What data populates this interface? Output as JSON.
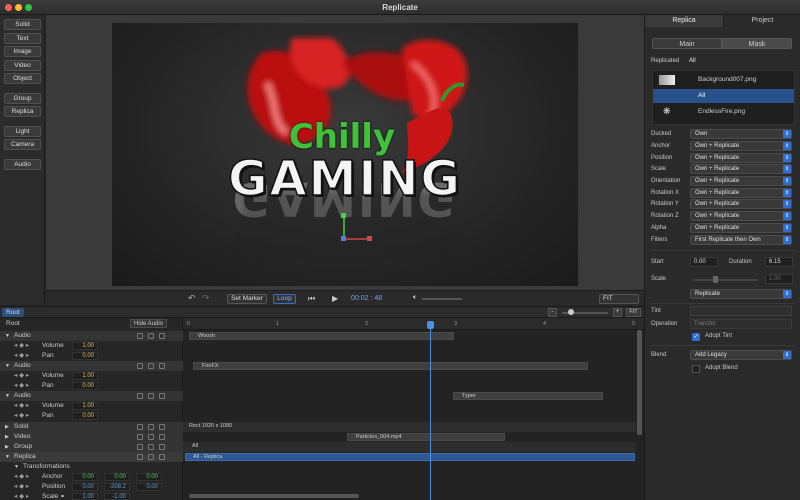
{
  "window": {
    "title": "Replicate"
  },
  "toolbar": {
    "items": [
      "Solid",
      "Text",
      "Image",
      "Video",
      "Object",
      "Group",
      "Replica",
      "Light",
      "Camera",
      "Audio"
    ]
  },
  "viewer": {
    "title_line1": "Chilly",
    "title_line2": "GAMING"
  },
  "transport": {
    "set_marker": "Set Marker",
    "loop": "Loop",
    "time": "00:02 : 48",
    "fit": "FIT"
  },
  "timeline": {
    "root_tab": "Root",
    "root_label": "Root",
    "hide_audio": "Hide Audio",
    "fit": "FIT",
    "ticks": [
      "0",
      "1",
      "2",
      "3",
      "4",
      "5"
    ]
  },
  "layers": {
    "audio": "Audio",
    "volume": "Volume",
    "pan": "Pan",
    "vol1": "1.00",
    "pan1": "0.00",
    "vol2": "1.00",
    "pan2": "0.00",
    "vol3": "1.00",
    "pan3": "0.00",
    "solid": "Solid",
    "video": "Video",
    "group": "Group",
    "replica": "Replica",
    "transformations": "Transformations",
    "anchor": "Anchor",
    "position": "Position",
    "scale": "Scale",
    "anchor_vals": [
      "0.00",
      "0.00",
      "0.00"
    ],
    "position_vals": [
      "0.00",
      "-208.2",
      "0.00"
    ],
    "scale_vals": [
      "1.00",
      "-1.00"
    ]
  },
  "clips": {
    "whoosh": "Woosh",
    "firefx": "FireFX",
    "typer": "Typer",
    "rect": "Rect 1920 x 1080",
    "particles": "Particles_004.mp4",
    "all": "All",
    "all_replica": "All - Replica"
  },
  "right": {
    "tab_replica": "Replica",
    "tab_project": "Project",
    "main": "Main",
    "mask": "Mask",
    "replicated_label": "Replicated",
    "replicated_value": "All",
    "list": [
      "Background007.png",
      "All",
      "EndlessFire.png"
    ],
    "props": [
      {
        "label": "Ducked",
        "value": "Own"
      },
      {
        "label": "Anchor",
        "value": "Own + Replicate"
      },
      {
        "label": "Position",
        "value": "Own + Replicate"
      },
      {
        "label": "Scale",
        "value": "Own + Replicate"
      },
      {
        "label": "Orientation",
        "value": "Own + Replicate"
      },
      {
        "label": "Rotation X",
        "value": "Own + Replicate"
      },
      {
        "label": "Rotation Y",
        "value": "Own + Replicate"
      },
      {
        "label": "Rotation Z",
        "value": "Own + Replicate"
      },
      {
        "label": "Alpha",
        "value": "Own + Replicate"
      },
      {
        "label": "Filters",
        "value": "First Replicate then Own"
      }
    ],
    "start_label": "Start",
    "start_value": "0.00",
    "duration_label": "Duration",
    "duration_value": "6.15",
    "scale_label": "Scale",
    "scale_value": "1.00",
    "scale_mode": "Replicate",
    "tint_label": "Tint",
    "operation_label": "Operation",
    "operation_value": "Transfer",
    "adopt_tint": "Adopt Tint",
    "blend_label": "Blend",
    "blend_value": "Add Legacy",
    "adopt_blend": "Adopt Blend"
  },
  "colors": {
    "accent": "#2f6fd0",
    "chilly": "#3ec23a",
    "playhead": "#4a90e2"
  }
}
